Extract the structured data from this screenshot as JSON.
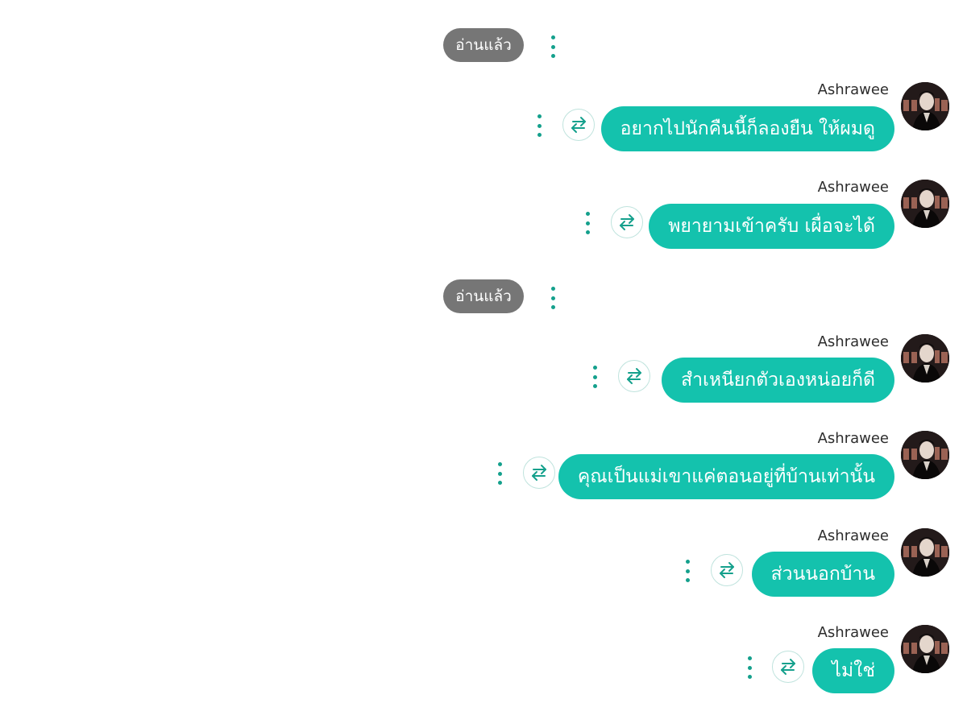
{
  "read_receipts": [
    {
      "label": "อ่านแล้ว"
    },
    {
      "label": "อ่านแล้ว"
    }
  ],
  "messages": [
    {
      "sender": "Ashrawee",
      "text": "อยากไปนักคืนนี้ก็ลองยืน ให้ผมดู"
    },
    {
      "sender": "Ashrawee",
      "text": "พยายามเข้าครับ เผื่อจะได้"
    },
    {
      "sender": "Ashrawee",
      "text": "สำเหนียกตัวเองหน่อยก็ดี"
    },
    {
      "sender": "Ashrawee",
      "text": "คุณเป็นแม่เขาแค่ตอนอยู่ที่บ้านเท่านั้น"
    },
    {
      "sender": "Ashrawee",
      "text": "ส่วนนอกบ้าน"
    },
    {
      "sender": "Ashrawee",
      "text": "ไม่ใช่"
    }
  ],
  "icons": {
    "more": "more-vertical-icon",
    "translate": "translate-arrows-icon",
    "avatar": "avatar-photo"
  },
  "colors": {
    "bubble": "#14c2ad",
    "accent": "#14a08c",
    "read_pill": "#767676",
    "translate_border": "#bfe3dd"
  }
}
